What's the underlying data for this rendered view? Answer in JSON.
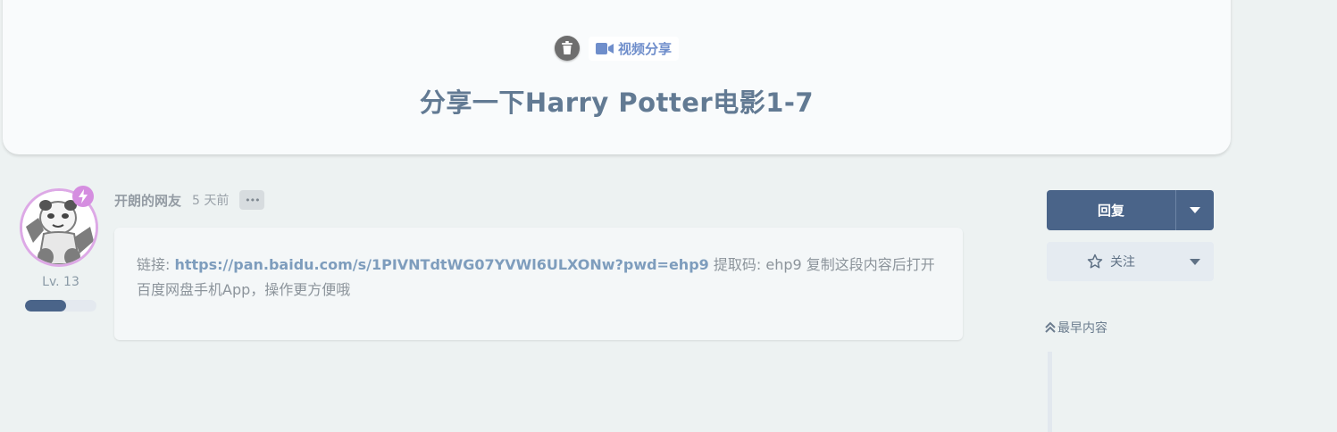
{
  "discussion": {
    "tag_label": "视频分享",
    "title": "分享一下Harry Potter电影1-7"
  },
  "post": {
    "username": "开朗的网友",
    "time": "5 天前",
    "more_label": "•••",
    "level_label": "Lv. 13",
    "level_progress": 0.58,
    "body_prefix": "链接: ",
    "link_text": "https://pan.baidu.com/s/1PIVNTdtWG07YVWl6ULXONw?pwd=ehp9",
    "body_suffix": " 提取码: ehp9 复制这段内容后打开百度网盘手机App，操作更方便哦"
  },
  "sidebar": {
    "reply_label": "回复",
    "follow_label": "关注",
    "earliest_label": "最早内容"
  },
  "colors": {
    "primary": "#4a6489",
    "tag": "#6f8ecb",
    "badge": "#d58ee0"
  },
  "icons": [
    "trash-icon",
    "video-icon",
    "lightning-icon",
    "more-icon",
    "caret-down-icon",
    "star-icon",
    "double-chevron-up-icon"
  ]
}
